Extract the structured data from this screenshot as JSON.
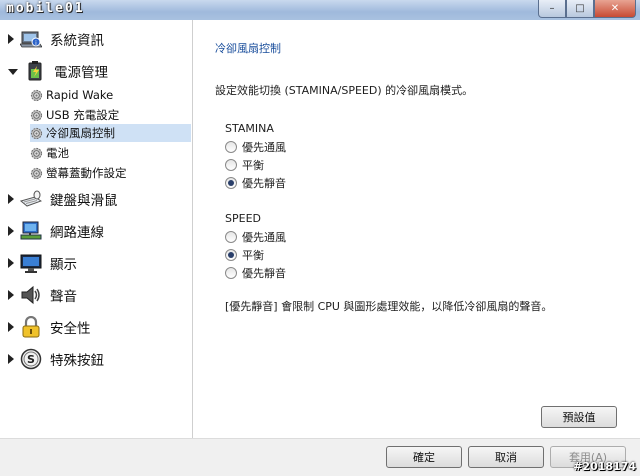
{
  "window": {
    "logo_text": "mobile01",
    "watermark": "#2018174",
    "controls": {
      "minimize": "–",
      "maximize": "□",
      "close": "✕"
    }
  },
  "sidebar": {
    "items": [
      {
        "label": "系統資訊",
        "icon": "laptop-info-icon",
        "expanded": false
      },
      {
        "label": "電源管理",
        "icon": "battery-power-icon",
        "expanded": true,
        "children": [
          {
            "label": "Rapid Wake",
            "selected": false
          },
          {
            "label": "USB 充電設定",
            "selected": false
          },
          {
            "label": "冷卻風扇控制",
            "selected": true
          },
          {
            "label": "電池",
            "selected": false
          },
          {
            "label": "螢幕蓋動作設定",
            "selected": false
          }
        ]
      },
      {
        "label": "鍵盤與滑鼠",
        "icon": "keyboard-mouse-icon",
        "expanded": false
      },
      {
        "label": "網路連線",
        "icon": "network-icon",
        "expanded": false
      },
      {
        "label": "顯示",
        "icon": "monitor-icon",
        "expanded": false
      },
      {
        "label": "聲音",
        "icon": "speaker-icon",
        "expanded": false
      },
      {
        "label": "安全性",
        "icon": "lock-icon",
        "expanded": false
      },
      {
        "label": "特殊按鈕",
        "icon": "special-button-icon",
        "expanded": false
      }
    ]
  },
  "main": {
    "title": "冷卻風扇控制",
    "description": "設定效能切換 (STAMINA/SPEED) 的冷卻風扇模式。",
    "groups": [
      {
        "label": "STAMINA",
        "options": [
          "優先通風",
          "平衡",
          "優先靜音"
        ],
        "selected_index": 2
      },
      {
        "label": "SPEED",
        "options": [
          "優先通風",
          "平衡",
          "優先靜音"
        ],
        "selected_index": 1
      }
    ],
    "note": "[優先靜音] 會限制 CPU 與圖形處理效能，以降低冷卻風扇的聲音。",
    "default_button": "預設值"
  },
  "footer": {
    "ok": "確定",
    "cancel": "取消",
    "apply": "套用(A)"
  }
}
